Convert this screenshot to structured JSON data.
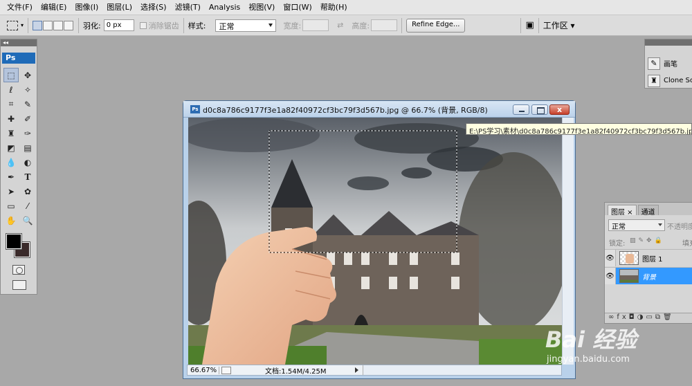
{
  "menubar": {
    "items": [
      "文件(F)",
      "编辑(E)",
      "图像(I)",
      "图层(L)",
      "选择(S)",
      "滤镜(T)",
      "Analysis",
      "视图(V)",
      "窗口(W)",
      "帮助(H)"
    ]
  },
  "options": {
    "feather_label": "羽化:",
    "feather_value": "0 px",
    "antialias_label": "消除锯齿",
    "style_label": "样式:",
    "style_value": "正常",
    "width_label": "宽度:",
    "height_label": "高度:",
    "refine_edge": "Refine Edge...",
    "workspace": "工作区 ▾"
  },
  "tools": {
    "ps_logo": "Ps"
  },
  "document": {
    "title": "d0c8a786c9177f3e1a82f40972cf3bc79f3d567b.jpg @ 66.7% (背景, RGB/8)",
    "close_glyph": "x",
    "zoom": "66.67%",
    "doc_size": "文档:1.54M/4.25M"
  },
  "tooltip": {
    "path": "E:\\PS学习\\素材\\d0c8a786c9177f3e1a82f40972cf3bc79f3d567b.jpg"
  },
  "rpanel": {
    "brush": "画笔",
    "clone": "Clone Sc"
  },
  "layers": {
    "tab_layers": "图层 ×",
    "tab_channels": "通道",
    "blend_mode": "正常",
    "opacity_label": "不透明度",
    "lock_label": "锁定:",
    "fill_label": "填充",
    "items": [
      {
        "name": "图层 1"
      },
      {
        "name": "背景"
      }
    ]
  },
  "watermark": {
    "brand": "Bai 经验",
    "url": "jingyan.baidu.com"
  }
}
